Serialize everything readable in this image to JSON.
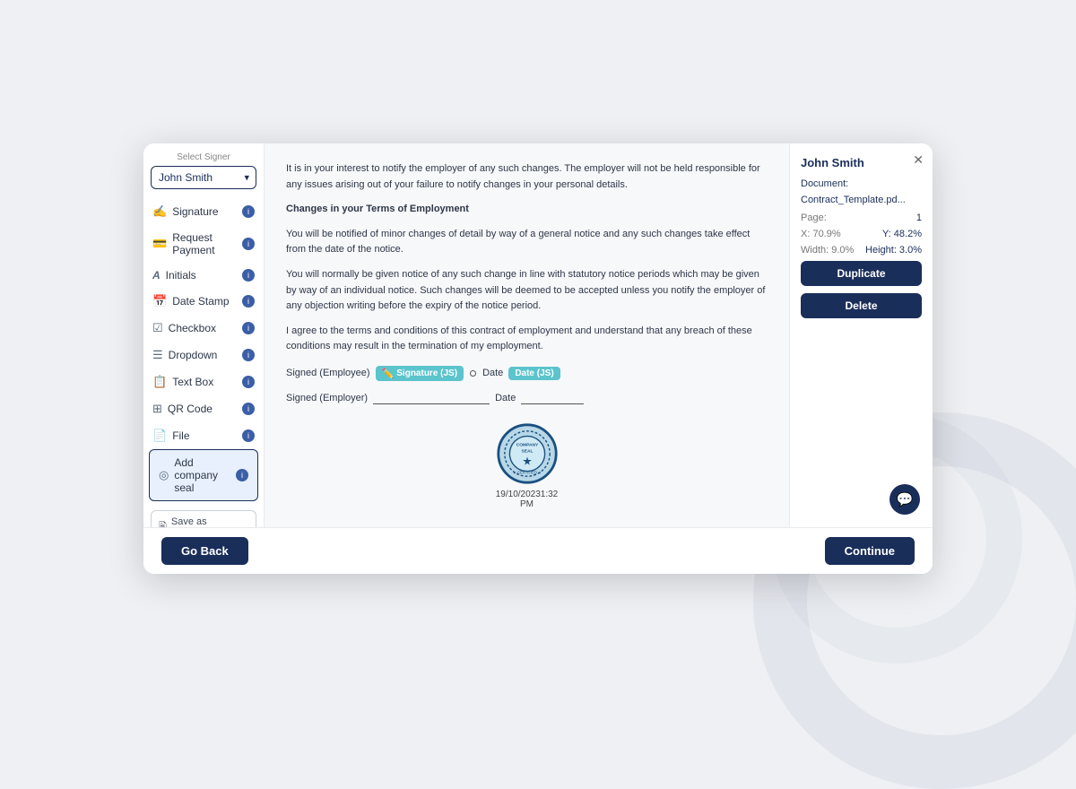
{
  "sidebar": {
    "select_signer_label": "Select Signer",
    "signer_name": "John Smith",
    "items": [
      {
        "id": "signature",
        "label": "Signature",
        "icon": "✍️"
      },
      {
        "id": "request-payment",
        "label": "Request Payment",
        "icon": "💳"
      },
      {
        "id": "initials",
        "label": "Initials",
        "icon": "A"
      },
      {
        "id": "date-stamp",
        "label": "Date Stamp",
        "icon": "📅"
      },
      {
        "id": "checkbox",
        "label": "Checkbox",
        "icon": "☑"
      },
      {
        "id": "dropdown",
        "label": "Dropdown",
        "icon": "☰"
      },
      {
        "id": "text-box",
        "label": "Text Box",
        "icon": "📋"
      },
      {
        "id": "qr-code",
        "label": "QR Code",
        "icon": "⊞"
      },
      {
        "id": "file",
        "label": "File",
        "icon": "📄"
      },
      {
        "id": "add-company-seal",
        "label": "Add company seal",
        "icon": "◎",
        "active": true
      }
    ],
    "save_template_label": "Save as Template"
  },
  "document": {
    "intro_text": "It is in your interest to notify the employer of any such changes. The employer will not be held responsible for any issues arising out of your failure to notify changes in your personal details.",
    "section_title": "Changes in your Terms of Employment",
    "section_text1": "You will be notified of minor changes of detail by way of a general notice and any such changes take effect from the date of the notice.",
    "section_text2": "You will normally be given notice of any such change in line with statutory notice periods which may be given by way of an individual notice. Such changes will be deemed to be accepted unless you notify the employer of any objection writing before the expiry of the notice period.",
    "section_text3": "I agree to the terms and conditions of this contract of employment and understand that any breach of these conditions may result in the termination of my employment.",
    "signed_employee": "Signed (Employee)",
    "signed_employer": "Signed (Employer)",
    "date_label": "Date",
    "sig_field_label": "Signature (JS)",
    "date_field_label": "Date (JS)",
    "seal_timestamp": "19/10/20231:32\nPM"
  },
  "right_panel": {
    "name": "John Smith",
    "document_label": "Document:",
    "document_value": "Contract_Template.pd...",
    "page_label": "Page:",
    "page_value": "1",
    "x_label": "X: 70.9%",
    "y_label": "Y: 48.2%",
    "width_label": "Width: 9.0%",
    "height_label": "Height: 3.0%",
    "duplicate_label": "Duplicate",
    "delete_label": "Delete"
  },
  "footer": {
    "go_back_label": "Go Back",
    "continue_label": "Continue"
  }
}
